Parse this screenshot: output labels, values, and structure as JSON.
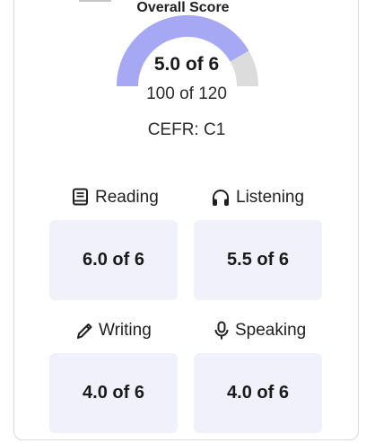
{
  "overall": {
    "title": "Overall Score",
    "score": "5.0 of 6",
    "raw": "100 of 120",
    "cefr": "CEFR: C1",
    "fraction": 0.833,
    "fill_color": "#a6a8f4",
    "track_color": "#dcdcdc"
  },
  "skills": [
    {
      "label": "Reading",
      "score": "6.0 of 6",
      "icon": "book-icon"
    },
    {
      "label": "Listening",
      "score": "5.5 of 6",
      "icon": "headphones-icon"
    },
    {
      "label": "Writing",
      "score": "4.0 of 6",
      "icon": "pencil-icon"
    },
    {
      "label": "Speaking",
      "score": "4.0 of 6",
      "icon": "microphone-icon"
    }
  ],
  "colors": {
    "box_bg": "#f1f1fb",
    "text": "#1a1a1a"
  }
}
